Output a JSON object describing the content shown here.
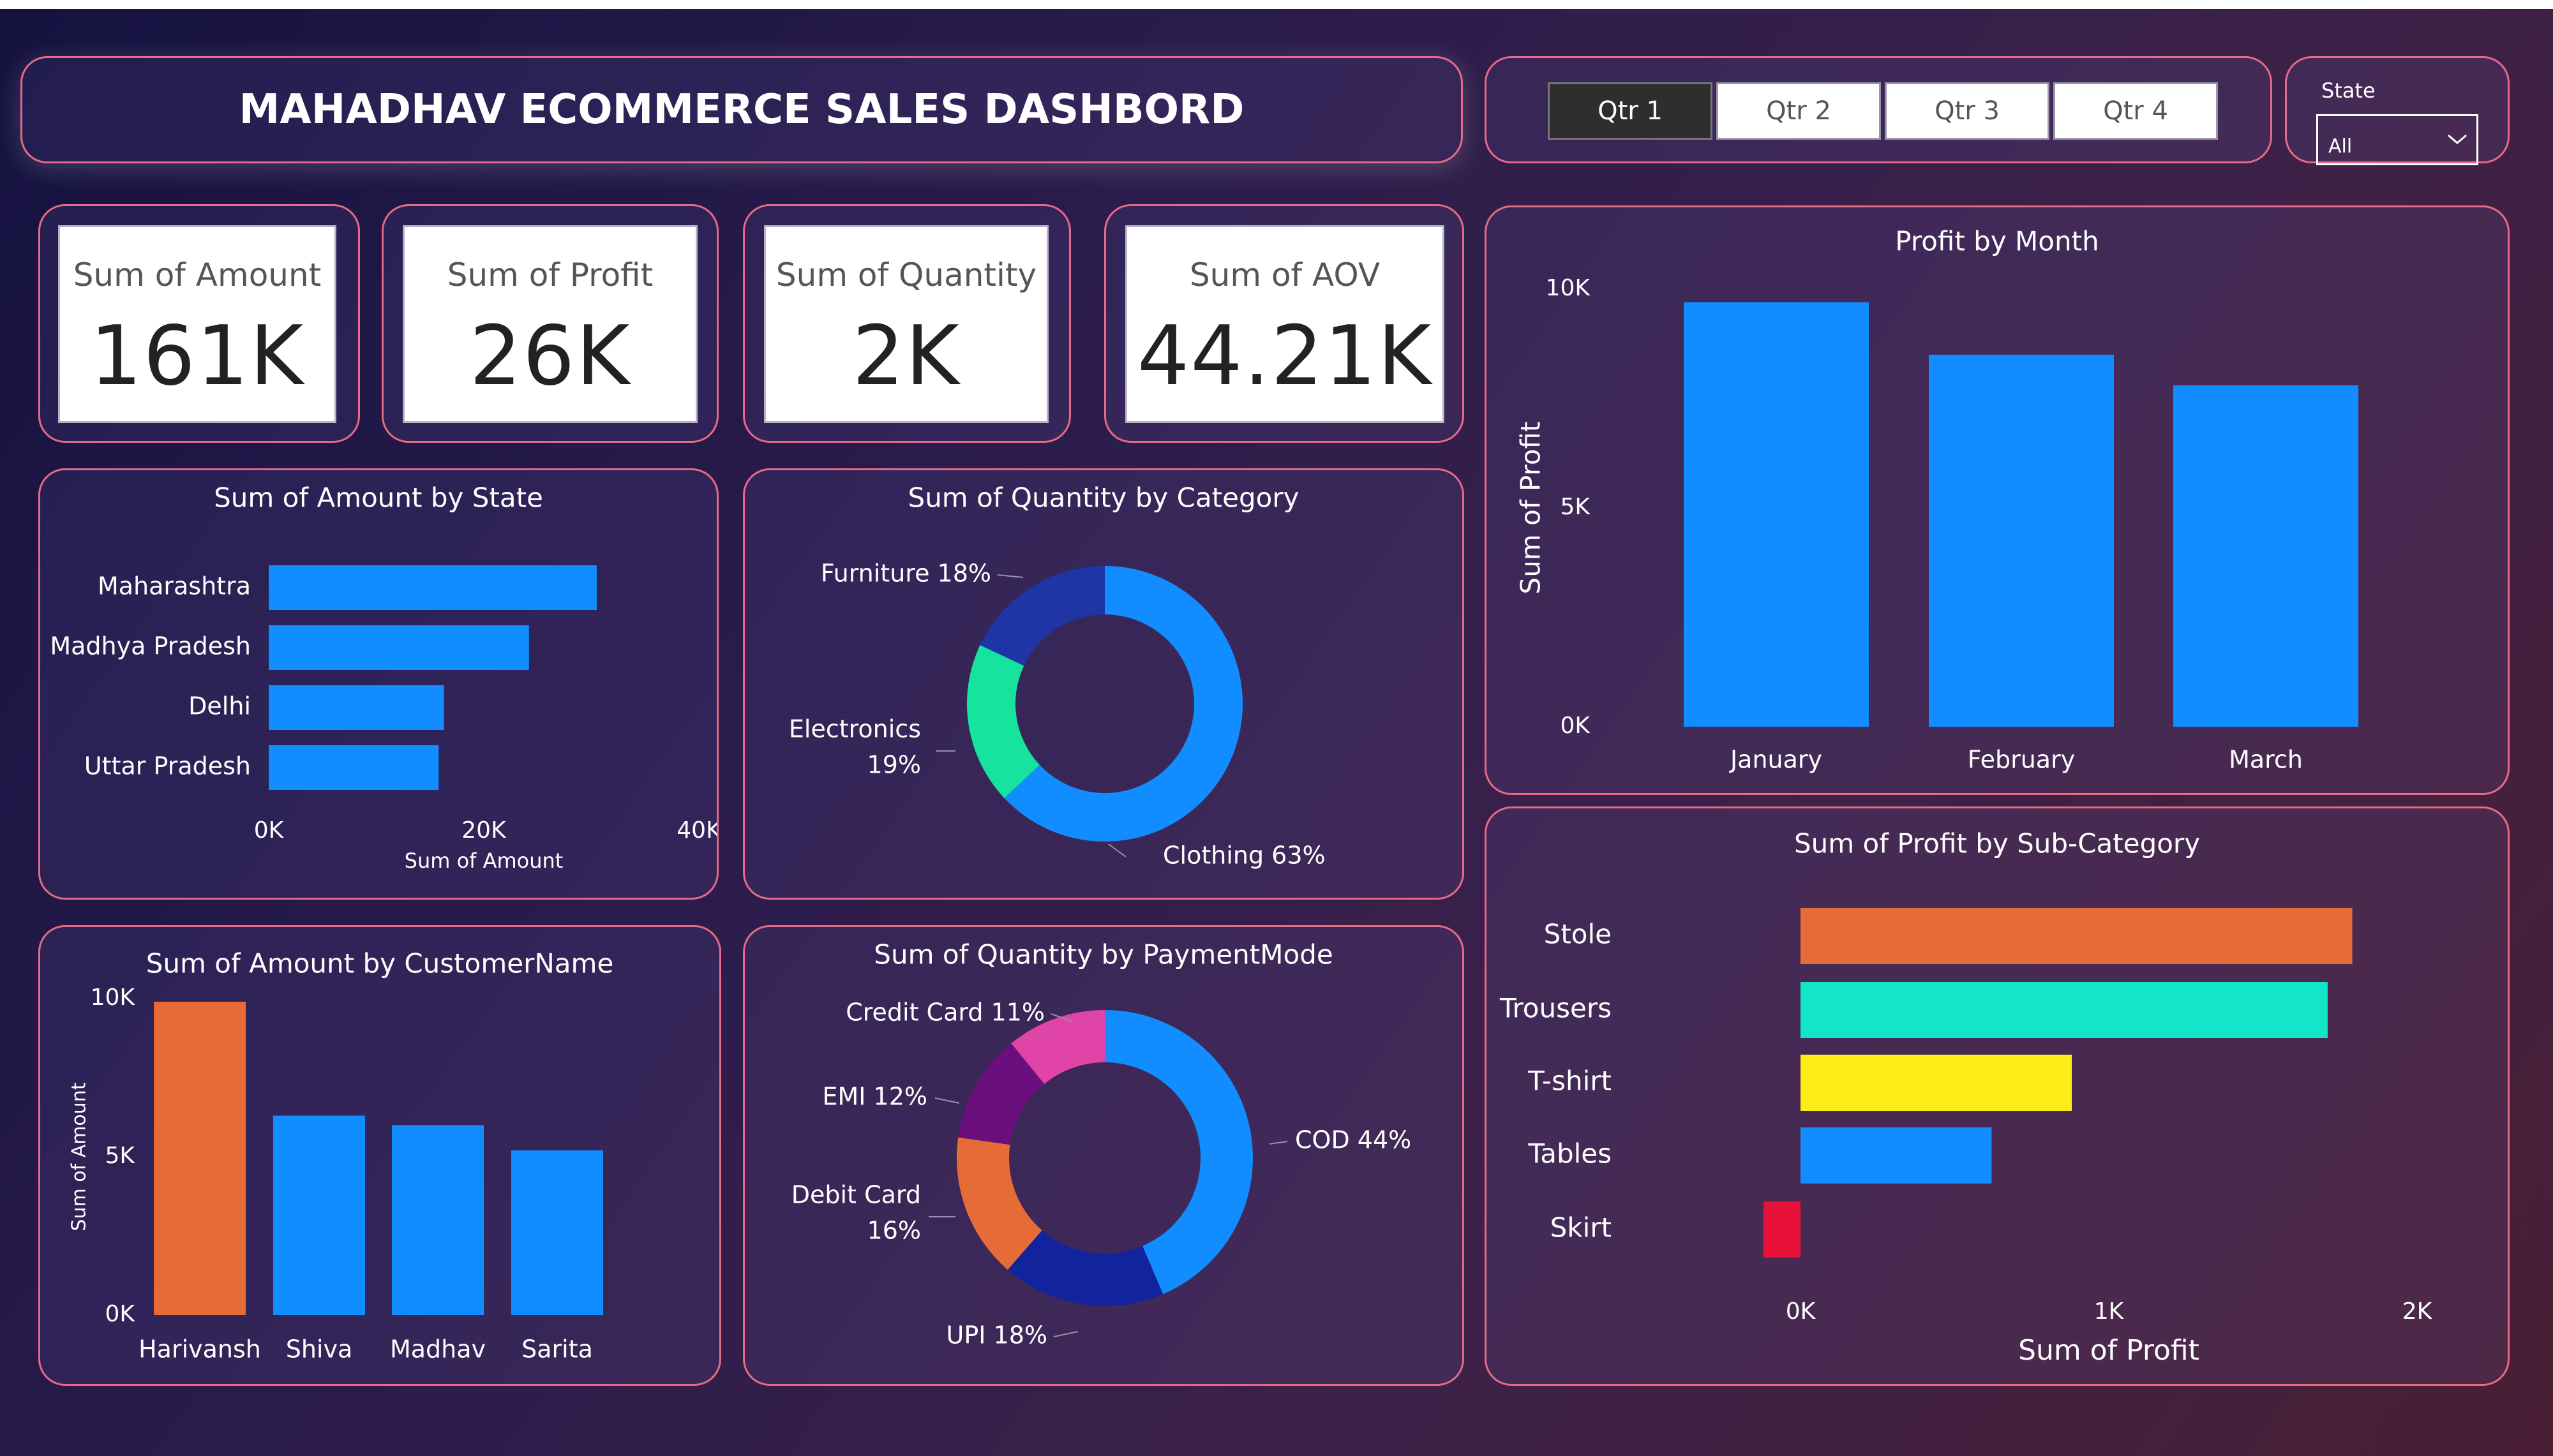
{
  "header": {
    "title": "MAHADHAV ECOMMERCE SALES DASHBORD"
  },
  "slicers": {
    "quarters": [
      "Qtr 1",
      "Qtr 2",
      "Qtr 3",
      "Qtr 4"
    ],
    "active_quarter": "Qtr 1",
    "state_label": "State",
    "state_value": "All"
  },
  "kpis": [
    {
      "label": "Sum of Amount",
      "value": "161K"
    },
    {
      "label": "Sum of Profit",
      "value": "26K"
    },
    {
      "label": "Sum of Quantity",
      "value": "2K"
    },
    {
      "label": "Sum of AOV",
      "value": "44.21K"
    }
  ],
  "colors": {
    "blue": "#118dff",
    "orange": "#e66c37",
    "teal": "#12e5c8",
    "yellow": "#fdec18",
    "red": "#e8113a",
    "darkblue": "#1f35a6",
    "green": "#16e39d",
    "magenta": "#e044a7",
    "purple": "#6b0f7f",
    "navy": "#12239e",
    "border": "#e76a86"
  },
  "chart_data": [
    {
      "id": "amount_by_state",
      "type": "bar",
      "orientation": "horizontal",
      "title": "Sum of Amount by State",
      "categories": [
        "Maharashtra",
        "Madhya Pradesh",
        "Delhi",
        "Uttar Pradesh"
      ],
      "values": [
        30500,
        24200,
        16300,
        15800
      ],
      "xlabel": "Sum of Amount",
      "ylabel": "",
      "xlim": [
        0,
        40000
      ],
      "ticks": [
        "0K",
        "20K",
        "40K"
      ],
      "tick_values": [
        0,
        20000,
        40000
      ]
    },
    {
      "id": "quantity_by_category",
      "type": "pie",
      "donut": true,
      "title": "Sum of Quantity by Category",
      "slices": [
        {
          "label": "Clothing 63%",
          "value": 63,
          "color": "#118dff"
        },
        {
          "label": "Electronics 19%",
          "label_lines": [
            "Electronics",
            "19%"
          ],
          "value": 19,
          "color": "#16e39d"
        },
        {
          "label": "Furniture 18%",
          "value": 18,
          "color": "#1f35a6"
        }
      ]
    },
    {
      "id": "amount_by_customer",
      "type": "bar",
      "orientation": "vertical",
      "title": "Sum of Amount by CustomerName",
      "categories": [
        "Harivansh",
        "Shiva",
        "Madhav",
        "Sarita"
      ],
      "values": [
        9900,
        6300,
        6000,
        5200
      ],
      "colors": [
        "#e66c37",
        "#118dff",
        "#118dff",
        "#118dff"
      ],
      "xlabel": "",
      "ylabel": "Sum of Amount",
      "ylim": [
        0,
        10000
      ],
      "ticks": [
        "0K",
        "5K",
        "10K"
      ],
      "tick_values": [
        0,
        5000,
        10000
      ]
    },
    {
      "id": "quantity_by_payment",
      "type": "pie",
      "donut": true,
      "title": "Sum of Quantity by PaymentMode",
      "slices": [
        {
          "label": "COD 44%",
          "value": 44,
          "color": "#118dff"
        },
        {
          "label": "UPI 18%",
          "value": 18,
          "color": "#12239e"
        },
        {
          "label": "Debit Card 16%",
          "label_lines": [
            "Debit Card",
            "16%"
          ],
          "value": 16,
          "color": "#e66c37"
        },
        {
          "label": "EMI 12%",
          "value": 12,
          "color": "#6b0f7f"
        },
        {
          "label": "Credit Card 11%",
          "value": 11,
          "color": "#e044a7"
        }
      ]
    },
    {
      "id": "profit_by_month",
      "type": "bar",
      "orientation": "vertical",
      "title": "Profit by Month",
      "categories": [
        "January",
        "February",
        "March"
      ],
      "values": [
        9700,
        8500,
        7800
      ],
      "colors": [
        "#118dff",
        "#118dff",
        "#118dff"
      ],
      "xlabel": "",
      "ylabel": "Sum of Profit",
      "ylim": [
        0,
        10000
      ],
      "ticks": [
        "0K",
        "5K",
        "10K"
      ],
      "tick_values": [
        0,
        5000,
        10000
      ]
    },
    {
      "id": "profit_by_subcategory",
      "type": "bar",
      "orientation": "horizontal",
      "title": "Sum of Profit by Sub-Category",
      "categories": [
        "Stole",
        "Trousers",
        "T-shirt",
        "Tables",
        "Skirt"
      ],
      "values": [
        1790,
        1710,
        880,
        620,
        -120
      ],
      "colors": [
        "#e66c37",
        "#12e5c8",
        "#fdec18",
        "#118dff",
        "#e8113a"
      ],
      "xlabel": "Sum of Profit",
      "ylabel": "",
      "xlim": [
        0,
        2000
      ],
      "ticks": [
        "0K",
        "1K",
        "2K"
      ],
      "tick_values": [
        0,
        1000,
        2000
      ]
    }
  ]
}
